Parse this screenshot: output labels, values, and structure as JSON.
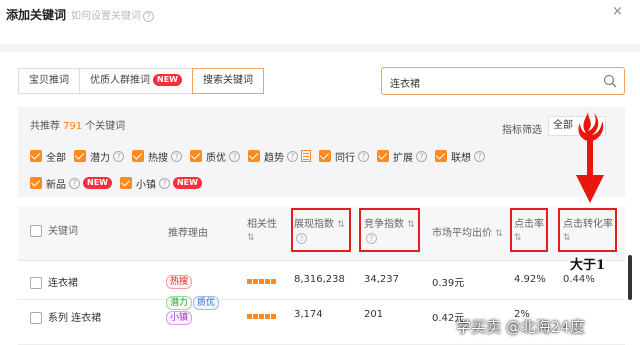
{
  "header": {
    "title": "添加关键词",
    "help_link": "如何设置关键词",
    "close": "×"
  },
  "tabs": [
    {
      "label": "宝贝推词",
      "badge": ""
    },
    {
      "label": "优质人群推词",
      "badge": "NEW"
    },
    {
      "label": "搜索关键词",
      "badge": ""
    }
  ],
  "search": {
    "value": "连衣裙"
  },
  "filter": {
    "rec_prefix": "共推荐",
    "rec_count": "791",
    "rec_suffix": "个关键词",
    "metric_label": "指标筛选",
    "metric_value": "全部",
    "checkboxes_row1": [
      {
        "label": "全部"
      },
      {
        "label": "潜力"
      },
      {
        "label": "热搜"
      },
      {
        "label": "质优"
      },
      {
        "label": "趋势"
      },
      {
        "label": "同行"
      },
      {
        "label": "扩展"
      },
      {
        "label": "联想"
      }
    ],
    "checkboxes_row2": [
      {
        "label": "新品",
        "badge": "NEW"
      },
      {
        "label": "小镇",
        "badge": "NEW"
      }
    ]
  },
  "table": {
    "headers": {
      "keyword": "关键词",
      "reason": "推荐理由",
      "relevance": "相关性",
      "impressions": "展现指数",
      "competition": "竞争指数",
      "avg_bid": "市场平均出价",
      "ctr": "点击率",
      "cvr": "点击转化率"
    },
    "rows": [
      {
        "keyword": "连衣裙",
        "reasons": [
          {
            "text": "热搜",
            "color": "red"
          }
        ],
        "relevance": 5,
        "impressions": "8,316,238",
        "competition": "34,237",
        "avg_bid": "0.39元",
        "ctr": "4.92%",
        "cvr": "0.44%"
      },
      {
        "keyword": "系列 连衣裙",
        "reasons": [
          {
            "text": "潜力",
            "color": "green"
          },
          {
            "text": "质优",
            "color": "blue"
          },
          {
            "text": "小镇",
            "color": "purple"
          }
        ],
        "relevance": 5,
        "impressions": "3,174",
        "competition": "201",
        "avg_bid": "0.42元",
        "ctr": "2%",
        "cvr": ""
      }
    ]
  },
  "annotation": "大于1",
  "watermark": "学买卖 @北海24度",
  "colors": {
    "accent": "#ff8a1f",
    "highlight": "#e02020",
    "arrow": "#e8160c"
  }
}
